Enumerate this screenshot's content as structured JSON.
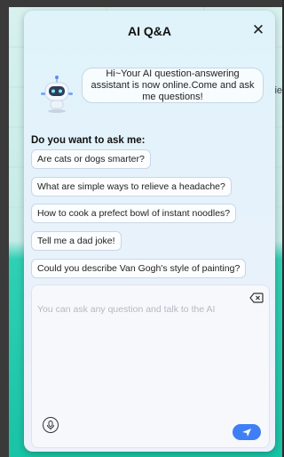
{
  "background": {
    "cut_text": "ie"
  },
  "panel": {
    "title": "AI Q&A",
    "close_symbol": "✕",
    "greeting": "Hi~Your AI question-answering assistant is now online.Come and ask me questions!",
    "ask_label": "Do you want to ask me:",
    "suggestions": [
      "Are cats or dogs smarter?",
      "What are simple ways to relieve a headache?",
      "How to cook a prefect bowl of instant noodles?",
      "Tell me a dad joke!",
      "Could you describe Van Gogh's style of painting?"
    ],
    "input": {
      "placeholder": "You can ask any question and talk to the AI"
    }
  },
  "colors": {
    "accent": "#3f7ff5",
    "panel_bg": "#e8f2fb",
    "teal": "#19c3a5"
  },
  "icons": {
    "close": "close-icon",
    "robot": "robot-avatar-icon",
    "clear": "backspace-icon",
    "voice": "microphone-icon",
    "send": "send-icon"
  }
}
